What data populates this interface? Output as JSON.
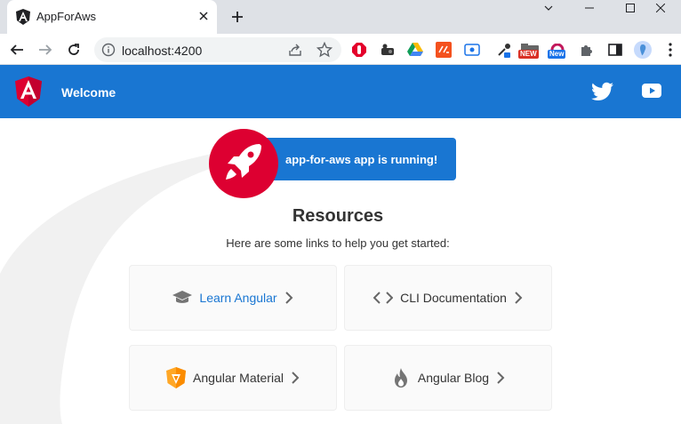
{
  "browser": {
    "tab_title": "AppForAws",
    "url": "localhost:4200",
    "extensions": {
      "new_badge_1": "NEW",
      "new_badge_2": "New"
    }
  },
  "header": {
    "title": "Welcome"
  },
  "main": {
    "running_text": "app-for-aws app is running!",
    "resources_title": "Resources",
    "resources_subtitle": "Here are some links to help you get started:",
    "cards": [
      {
        "label": "Learn Angular",
        "icon": "graduation-cap-icon"
      },
      {
        "label": "CLI Documentation",
        "icon": "code-brackets-icon"
      },
      {
        "label": "Angular Material",
        "icon": "angular-material-icon"
      },
      {
        "label": "Angular Blog",
        "icon": "flame-icon"
      }
    ]
  },
  "colors": {
    "primary": "#1976d2",
    "angular_red": "#dd0031",
    "chrome_bg": "#dee1e6"
  }
}
